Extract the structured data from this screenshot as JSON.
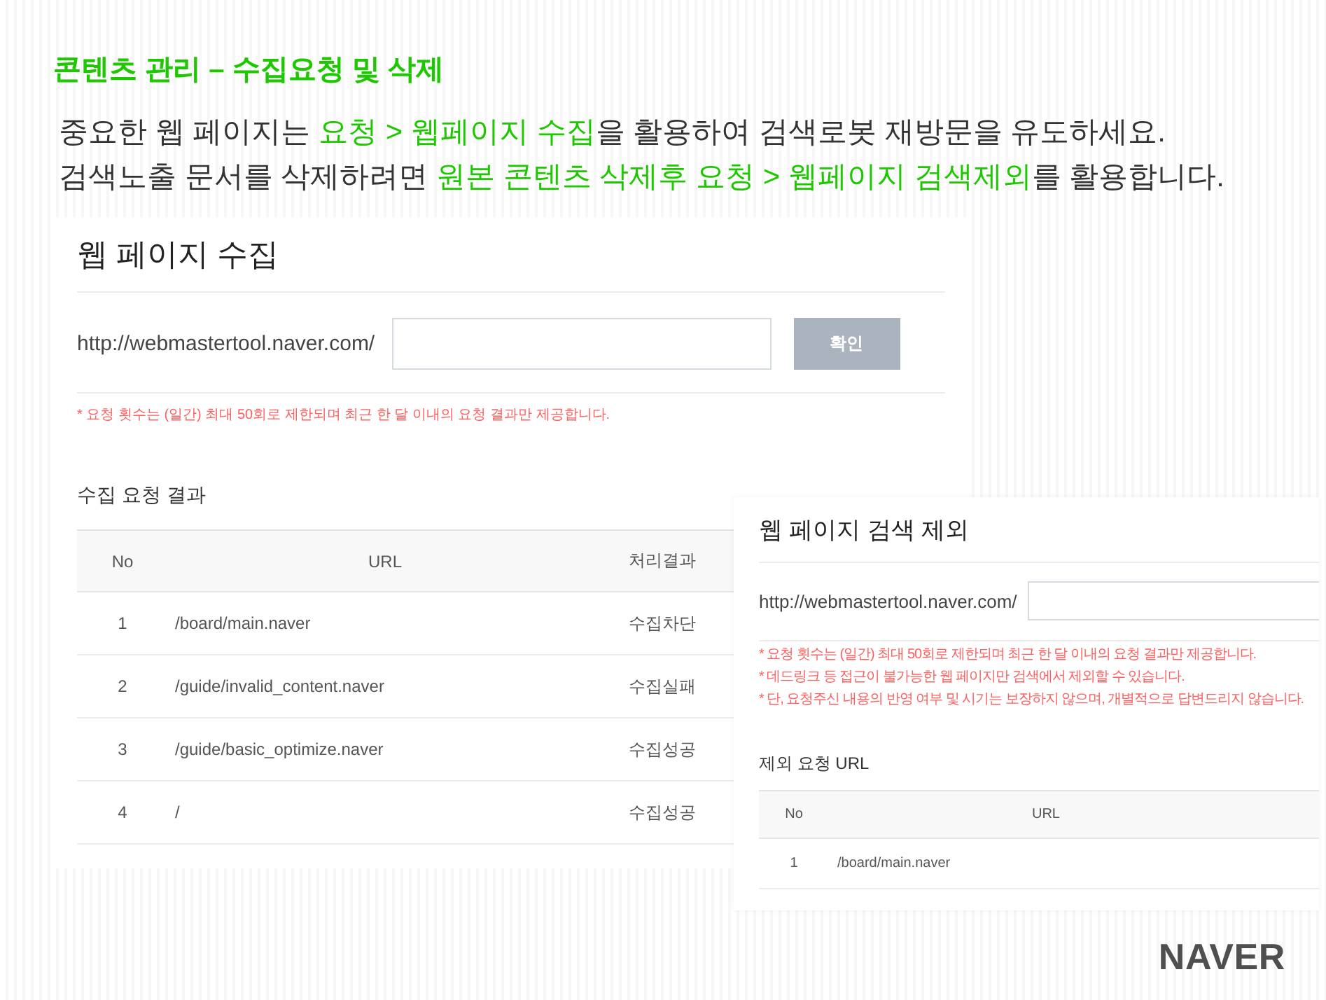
{
  "intro": {
    "title": "콘텐츠 관리 – 수집요청 및 삭제",
    "lines": [
      {
        "segments": [
          {
            "text": "중요한 웹 페이지는 ",
            "highlight": false
          },
          {
            "text": "요청 > 웹페이지 수집",
            "highlight": true
          },
          {
            "text": "을 활용하여 검색로봇 재방문을 유도하세요.",
            "highlight": false
          }
        ]
      },
      {
        "segments": [
          {
            "text": "검색노출 문서를 삭제하려면 ",
            "highlight": false
          },
          {
            "text": "원본 콘텐츠 삭제후 요청 > 웹페이지 검색제외",
            "highlight": true
          },
          {
            "text": "를 활용합니다.",
            "highlight": false
          }
        ]
      }
    ]
  },
  "collect_panel": {
    "title": "웹 페이지 수집",
    "url_prefix": "http://webmastertool.naver.com/",
    "confirm_button": {
      "label": "확인",
      "disabled": true
    },
    "note": "* 요청 횟수는 (일간) 최대 50회로 제한되며 최근 한 달 이내의 요청 결과만 제공합니다.",
    "results": {
      "title": "수집 요청 결과",
      "columns": [
        "No",
        "URL",
        "처리결과"
      ],
      "rows": [
        [
          "1",
          "/board/main.naver",
          "수집차단"
        ],
        [
          "2",
          "/guide/invalid_content.naver",
          "수집실패"
        ],
        [
          "3",
          "/guide/basic_optimize.naver",
          "수집성공"
        ],
        [
          "4",
          "/",
          "수집성공"
        ]
      ]
    }
  },
  "exclude_panel": {
    "title": "웹 페이지 검색 제외",
    "url_prefix": "http://webmastertool.naver.com/",
    "notes": [
      "* 요청 횟수는 (일간) 최대 50회로 제한되며 최근 한 달 이내의 요청 결과만 제공합니다.",
      "* 데드링크 등 접근이 불가능한 웹 페이지만 검색에서 제외할 수 있습니다.",
      "* 단, 요청주신 내용의 반영 여부 및 시기는 보장하지 않으며, 개별적으로 답변드리지 않습니다."
    ],
    "requests": {
      "title": "제외 요청 URL",
      "columns": [
        "No",
        "URL"
      ],
      "rows": [
        [
          "1",
          "/board/main.naver"
        ]
      ]
    }
  },
  "logo": "NAVER"
}
